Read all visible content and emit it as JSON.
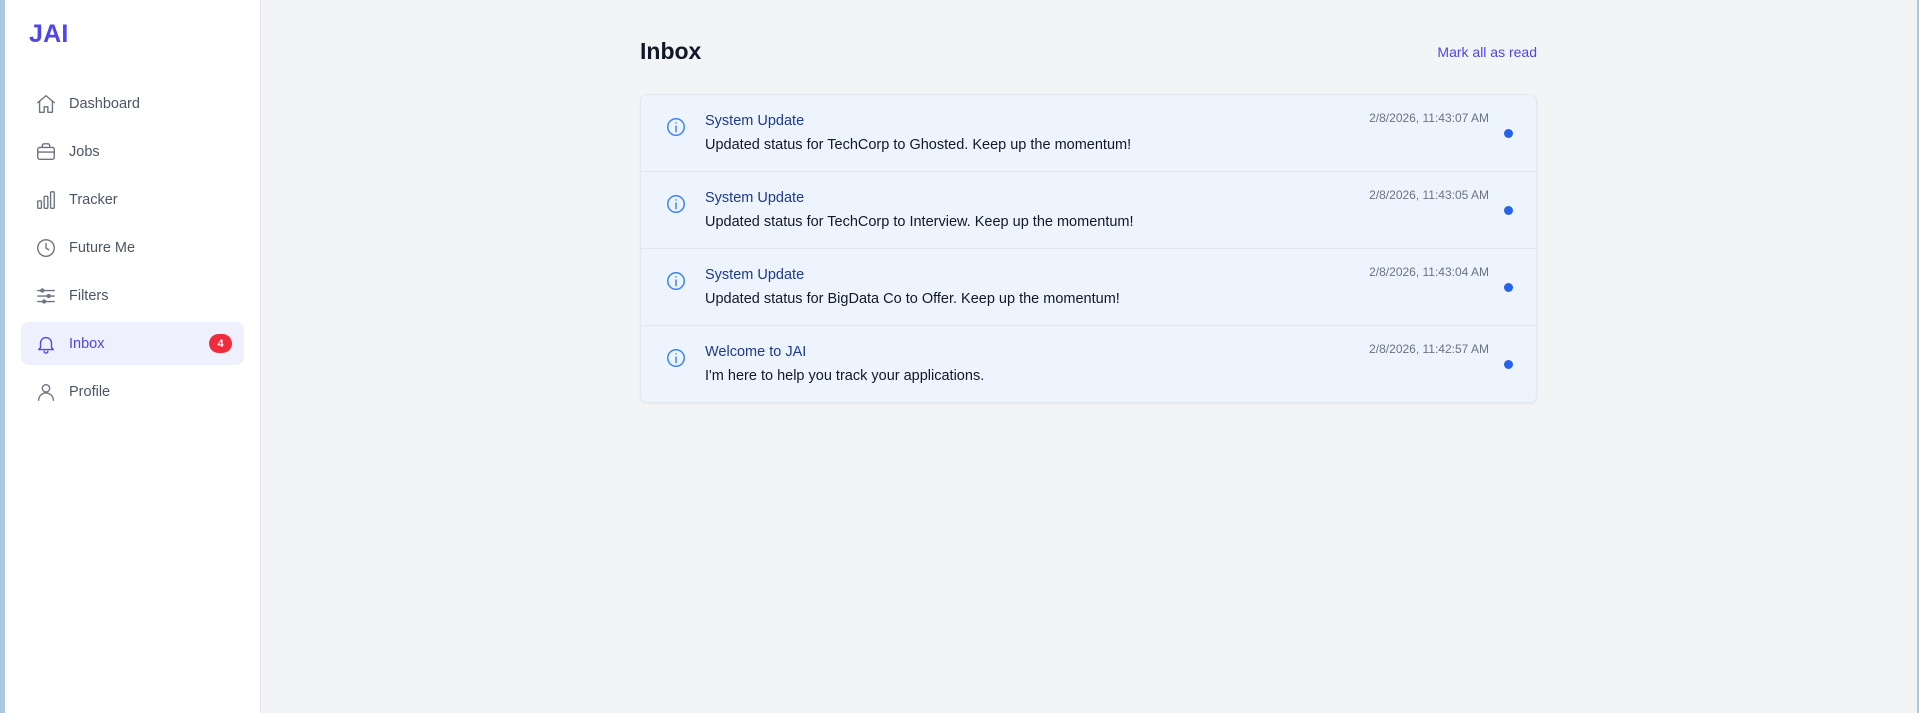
{
  "app": {
    "brand": "JAI",
    "accent": "#4f46e5"
  },
  "sidebar": {
    "items": [
      {
        "label": "Dashboard",
        "icon": "home-icon",
        "active": false
      },
      {
        "label": "Jobs",
        "icon": "briefcase-icon",
        "active": false
      },
      {
        "label": "Tracker",
        "icon": "bar-chart-icon",
        "active": false
      },
      {
        "label": "Future Me",
        "icon": "clock-icon",
        "active": false
      },
      {
        "label": "Filters",
        "icon": "sliders-icon",
        "active": false
      },
      {
        "label": "Inbox",
        "icon": "bell-icon",
        "active": true,
        "badge": "4"
      },
      {
        "label": "Profile",
        "icon": "user-icon",
        "active": false
      }
    ]
  },
  "inbox": {
    "title": "Inbox",
    "mark_all_label": "Mark all as read",
    "messages": [
      {
        "title": "System Update",
        "body": "Updated status for TechCorp to Ghosted. Keep up the momentum!",
        "time": "2/8/2026, 11:43:07 AM",
        "unread": true,
        "icon": "info-icon"
      },
      {
        "title": "System Update",
        "body": "Updated status for TechCorp to Interview. Keep up the momentum!",
        "time": "2/8/2026, 11:43:05 AM",
        "unread": true,
        "icon": "info-icon"
      },
      {
        "title": "System Update",
        "body": "Updated status for BigData Co to Offer. Keep up the momentum!",
        "time": "2/8/2026, 11:43:04 AM",
        "unread": true,
        "icon": "info-icon"
      },
      {
        "title": "Welcome to JAI",
        "body": "I'm here to help you track your applications.",
        "time": "2/8/2026, 11:42:57 AM",
        "unread": true,
        "icon": "info-icon"
      }
    ]
  }
}
